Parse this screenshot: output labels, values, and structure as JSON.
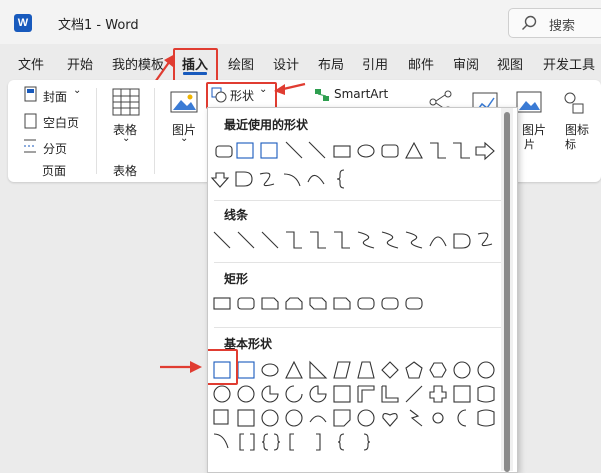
{
  "window": {
    "app_badge": "W",
    "doc_title": "文档1  -  Word",
    "search_label": "搜索"
  },
  "tabs": [
    "文件",
    "开始",
    "我的模板",
    "插入",
    "绘图",
    "设计",
    "布局",
    "引用",
    "邮件",
    "审阅",
    "视图",
    "开发工具"
  ],
  "ribbon": {
    "pages_group": {
      "cover": "封面",
      "blank": "空白页",
      "break": "分页",
      "label": "页面"
    },
    "table_group": {
      "button": "表格",
      "label": "表格"
    },
    "picture_button": "图片",
    "shapes_button": "形状",
    "smartart_button": "SmartArt",
    "right_picture_button": "图片",
    "icons_button": "图标"
  },
  "shapes_menu": {
    "recent": "最近使用的形状",
    "lines": "线条",
    "rectangles": "矩形",
    "basic": "基本形状"
  },
  "colors": {
    "accent": "#185abd",
    "highlight": "#e03c31"
  }
}
